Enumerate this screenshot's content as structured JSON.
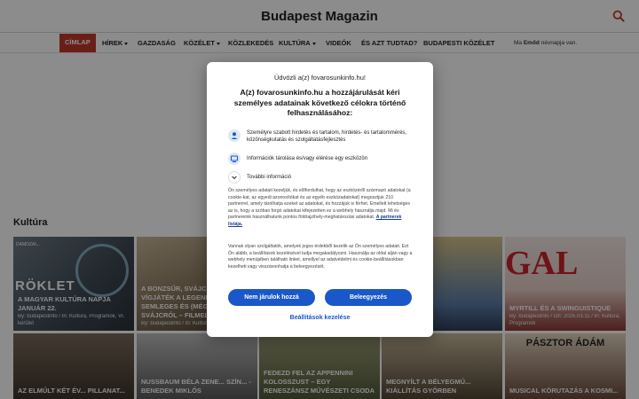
{
  "header": {
    "title": "Budapest Magazin",
    "search_icon": "search-icon"
  },
  "nav": {
    "items": [
      {
        "label": "Címlap",
        "caret": false
      },
      {
        "label": "Hírek",
        "caret": true
      },
      {
        "label": "Gazdaság",
        "caret": false
      },
      {
        "label": "Közélet",
        "caret": true
      },
      {
        "label": "Közlekedés",
        "caret": false
      },
      {
        "label": "Kultúra",
        "caret": true
      },
      {
        "label": "Videók",
        "caret": false
      },
      {
        "label": "És azt tudtad?",
        "caret": false
      },
      {
        "label": "Budapesti közélet",
        "caret": false
      }
    ],
    "nameday_prefix": "Ma",
    "nameday_name": "Emőd",
    "nameday_suffix": "névnapja van."
  },
  "section": {
    "title": "Kultúra"
  },
  "cards_row1": [
    {
      "title": "A magyar kultúra napja január 22.",
      "meta": "By: budapestinfo / In: Kultúra, Programok, VI. kerület",
      "logo": "RÖKLET",
      "small": "DAMOZAI..."
    },
    {
      "title": "A bonzsűr, svájc en... vígjáték a legend... semleges és (még)... svájcról – filmel...",
      "meta": "By: budapestinfo / In: Kultúra"
    },
    {
      "title": "Myrtill és a swinguistique",
      "meta": "By: budapestinfo / On: 2025.03.11 / In: Kultúra, Programok"
    }
  ],
  "cards_row2": [
    {
      "title": "Az elmúlt két év... pillanat..."
    },
    {
      "title": "Nussbaum Béla zene... szín... - Benedek Miklós"
    },
    {
      "title": "Fedezd fel az Appennini kolosszust – egy reneszánsz művészeti csoda"
    },
    {
      "title": "Megnyílt a bélyegmú... kiállítás Győrben"
    },
    {
      "title": "Musical körutazás a kosmi..."
    }
  ],
  "card_overlays": {
    "gal_text": "GAL",
    "pasztor_text": "PÁSZTOR ÁDÁM"
  },
  "consent": {
    "welcome": "Üdvözli a(z) fovarosunkinfo.hu!",
    "heading": "A(z) fovarosunkinfo.hu a hozzájárulását kéri személyes adatainak következő célokra történő felhasználásához:",
    "purposes": [
      {
        "icon": "person-icon",
        "text": "Személyre szabott hirdetés és tartalom, hirdetés- és tartalommérés, közönségkutatás és szolgáltatásfejlesztés"
      },
      {
        "icon": "device-icon",
        "text": "Információk tárolása és/vagy elérése egy eszközön"
      },
      {
        "icon": "chevron-down-icon",
        "text": "További információ"
      }
    ],
    "paragraph1": "Ön személyes adatait kezeljük, és előfordulhat, hogy az eszközéről származó adatokat (a cookie-kat, az egyedi azonosítókat és az egyéb eszközadatokat) megosztjuk 210 partnerrel, amely tárolhatja ezeket az adatokat, és hozzájuk is férhet. Emellett lehetséges az is, hogy a szóban forgó adatokat kifejezetten ez a webhely használja majd. Mi és partnereink használhatunk pontos földrajzihely-meghatározási adatokat.",
    "partners_link": "A partnerek listája.",
    "paragraph2": "Vannak olyan szolgáltatók, amelyek jogos érdekből kezelik az Ön személyes adatait. Ezt Ön alább, a beállítások kezelésével tudja megakadályozni. Használja az oldal alján vagy a webhely menüjében található linket, amellyel az adatvédelmi és cookie-beállításokban kezelheti vagy visszavonhatja a beleegyezését.",
    "decline": "Nem járulok hozzá",
    "accept": "Beleegyezés",
    "manage": "Beállítások kezelése"
  },
  "colors": {
    "accent": "#c0392b",
    "button": "#1a57c8"
  }
}
